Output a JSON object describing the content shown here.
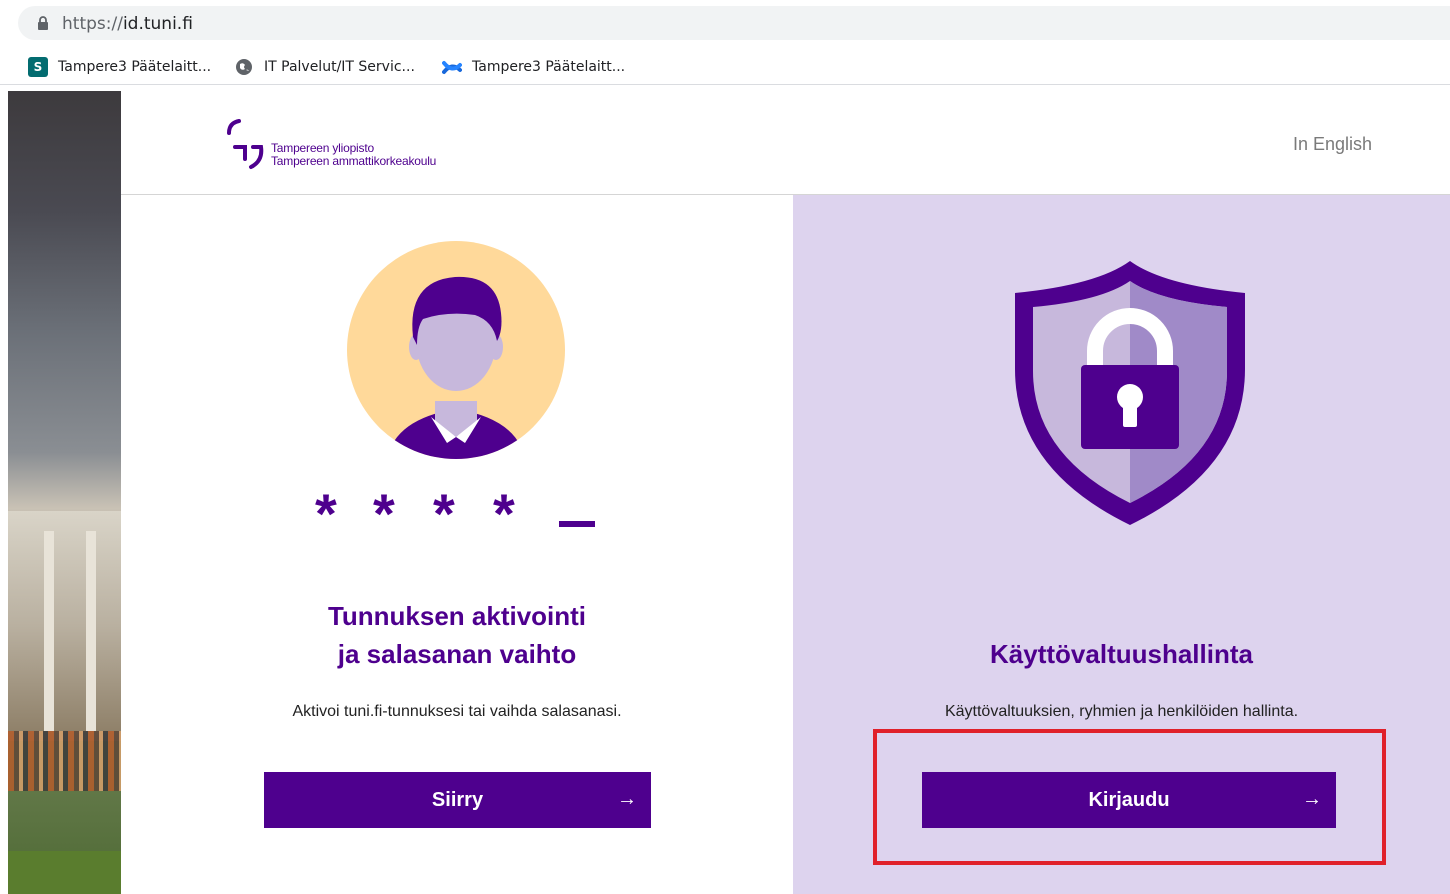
{
  "browser": {
    "url_scheme": "https://",
    "url_host": "id.tuni.fi",
    "bookmarks": [
      {
        "label": "Tampere3 Päätelaitt...",
        "icon": "sharepoint-icon"
      },
      {
        "label": "IT Palvelut/IT Servic...",
        "icon": "globe-icon"
      },
      {
        "label": "Tampere3 Päätelaitt...",
        "icon": "confluence-icon"
      }
    ]
  },
  "header": {
    "logo_line1": "Tampereen yliopisto",
    "logo_line2": "Tampereen ammattikorkeakoulu",
    "language_link": "In English"
  },
  "cards": [
    {
      "title_line1": "Tunnuksen aktivointi",
      "title_line2": "ja salasanan vaihto",
      "description": "Aktivoi tuni.fi-tunnuksesi tai vaihda salasanasi.",
      "button_label": "Siirry",
      "button_arrow": "→",
      "illustration": "user-password-icon"
    },
    {
      "title": "Käyttövaltuushallinta",
      "description": "Käyttövaltuuksien, ryhmien ja henkilöiden hallinta.",
      "button_label": "Kirjaudu",
      "button_arrow": "→",
      "illustration": "shield-lock-icon"
    }
  ],
  "colors": {
    "brand_purple": "#4e008e",
    "panel_lilac": "#ddd3ee",
    "avatar_bg": "#ffd99a",
    "highlight": "#e0202a"
  }
}
